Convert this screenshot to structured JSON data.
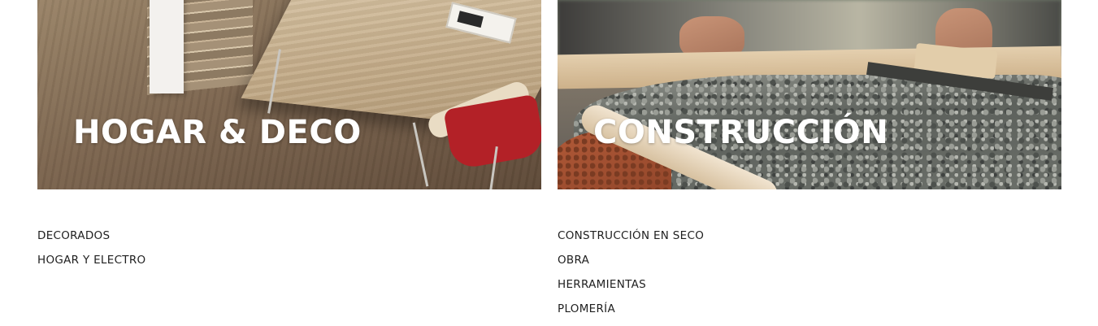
{
  "categories": [
    {
      "title": "HOGAR & DECO",
      "image": "living-room-table-chair-photo",
      "links": [
        "DECORADOS",
        "HOGAR Y ELECTRO"
      ]
    },
    {
      "title": "CONSTRUCCIÓN",
      "image": "concrete-pouring-photo",
      "links": [
        "CONSTRUCCIÓN EN SECO",
        "OBRA",
        "HERRAMIENTAS",
        "PLOMERÍA"
      ]
    }
  ],
  "colors": {
    "title_text": "#ffffff",
    "link_text": "#1f1f1f",
    "background": "#ffffff"
  }
}
